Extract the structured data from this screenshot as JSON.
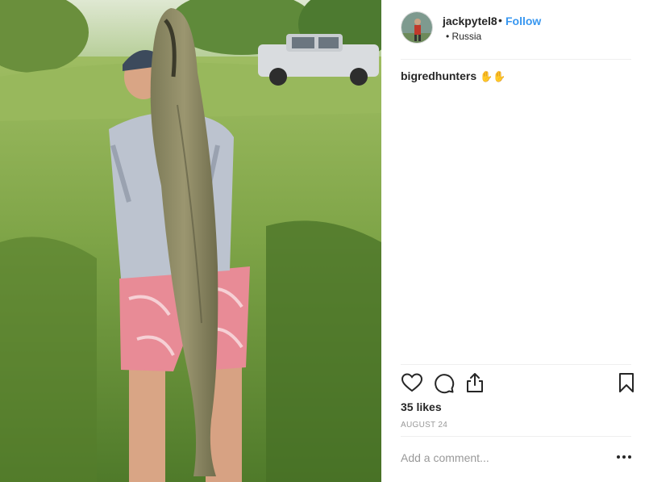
{
  "post": {
    "username": "jackpytel8",
    "separator": "•",
    "follow_label": "Follow",
    "location": "• Russia",
    "caption_user": "bigredhunters",
    "caption_emoji": "✋✋",
    "likes": "35 likes",
    "date": "AUGUST 24",
    "comment_placeholder": "Add a comment...",
    "icons": {
      "like": "heart-icon",
      "comment": "comment-icon",
      "share": "share-icon",
      "save": "bookmark-icon",
      "more": "more-options-icon"
    },
    "colors": {
      "follow": "#3897f0",
      "text": "#262626",
      "secondary": "#999999",
      "divider": "#efefef"
    }
  }
}
